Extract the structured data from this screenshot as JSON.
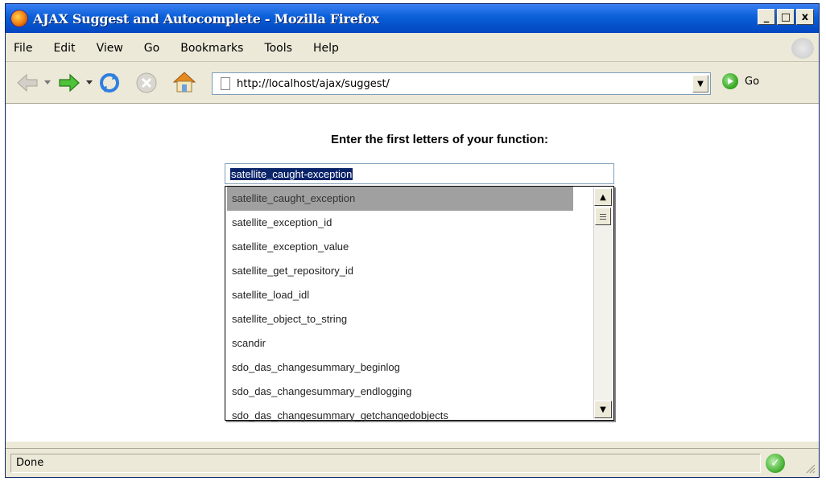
{
  "window": {
    "title": "AJAX Suggest and Autocomplete - Mozilla Firefox",
    "buttons": {
      "minimize": "_",
      "maximize": "□",
      "close": "x"
    }
  },
  "menubar": {
    "items": [
      "File",
      "Edit",
      "View",
      "Go",
      "Bookmarks",
      "Tools",
      "Help"
    ]
  },
  "navbar": {
    "url": "http://localhost/ajax/suggest/",
    "go_label": "Go",
    "icons": [
      "back-arrow-icon",
      "forward-arrow-icon",
      "reload-icon",
      "stop-icon",
      "home-icon"
    ]
  },
  "page": {
    "heading": "Enter the first letters of your function:",
    "input_value": "satellite_caught-exception",
    "suggestions": [
      "satellite_caught_exception",
      "satellite_exception_id",
      "satellite_exception_value",
      "satellite_get_repository_id",
      "satellite_load_idl",
      "satellite_object_to_string",
      "scandir",
      "sdo_das_changesummary_beginlog",
      "sdo_das_changesummary_endlogging",
      "sdo_das_changesummary_getchangedobjects"
    ],
    "selected_index": 0
  },
  "statusbar": {
    "text": "Done"
  },
  "colors": {
    "titlebar": "#0a5fd8",
    "selection": "#0a246a",
    "highlight": "#a0a0a0",
    "chrome": "#ece9d8"
  }
}
